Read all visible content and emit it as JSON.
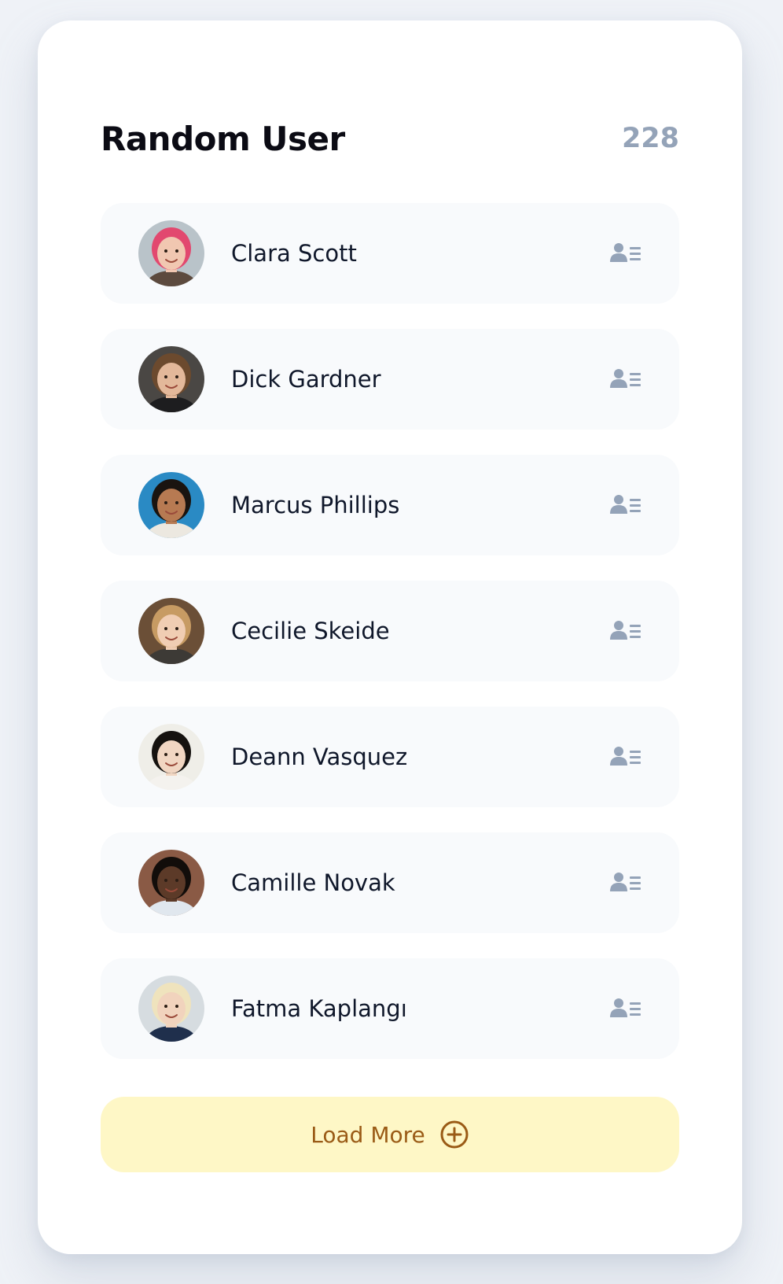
{
  "header": {
    "title": "Random User",
    "count": "228"
  },
  "users": [
    {
      "name": "Clara Scott",
      "avatar_bg": "#b9c3c9",
      "skin": "#f1c7b1",
      "hair": "#e2486f",
      "shirt": "#5c4a3e"
    },
    {
      "name": "Dick Gardner",
      "avatar_bg": "#4a4744",
      "skin": "#e3b89a",
      "hair": "#6c4a2e",
      "shirt": "#1d1d1f"
    },
    {
      "name": "Marcus Phillips",
      "avatar_bg": "#2a8ac4",
      "skin": "#b77a52",
      "hair": "#1a1410",
      "shirt": "#ece8e0"
    },
    {
      "name": "Cecilie Skeide",
      "avatar_bg": "#6b4f37",
      "skin": "#f0cdb3",
      "hair": "#c79b63",
      "shirt": "#3d3a36"
    },
    {
      "name": "Deann Vasquez",
      "avatar_bg": "#efeee8",
      "skin": "#f1d6c2",
      "hair": "#15120f",
      "shirt": "#f4f2ee"
    },
    {
      "name": "Camille Novak",
      "avatar_bg": "#8a5a45",
      "skin": "#5c3a28",
      "hair": "#120d0a",
      "shirt": "#e0e7ee"
    },
    {
      "name": "Fatma Kaplangı",
      "avatar_bg": "#d6dce0",
      "skin": "#f1d3bd",
      "hair": "#efe3bd",
      "shirt": "#1f2f4c"
    }
  ],
  "icons": {
    "detail": "contact-card-icon",
    "load_more": "plus-circle-icon"
  },
  "colors": {
    "icon_gray": "#94a3b8",
    "load_more_bg": "#fef7c6",
    "load_more_text": "#9a5b16"
  },
  "load_more": {
    "label": "Load More"
  }
}
